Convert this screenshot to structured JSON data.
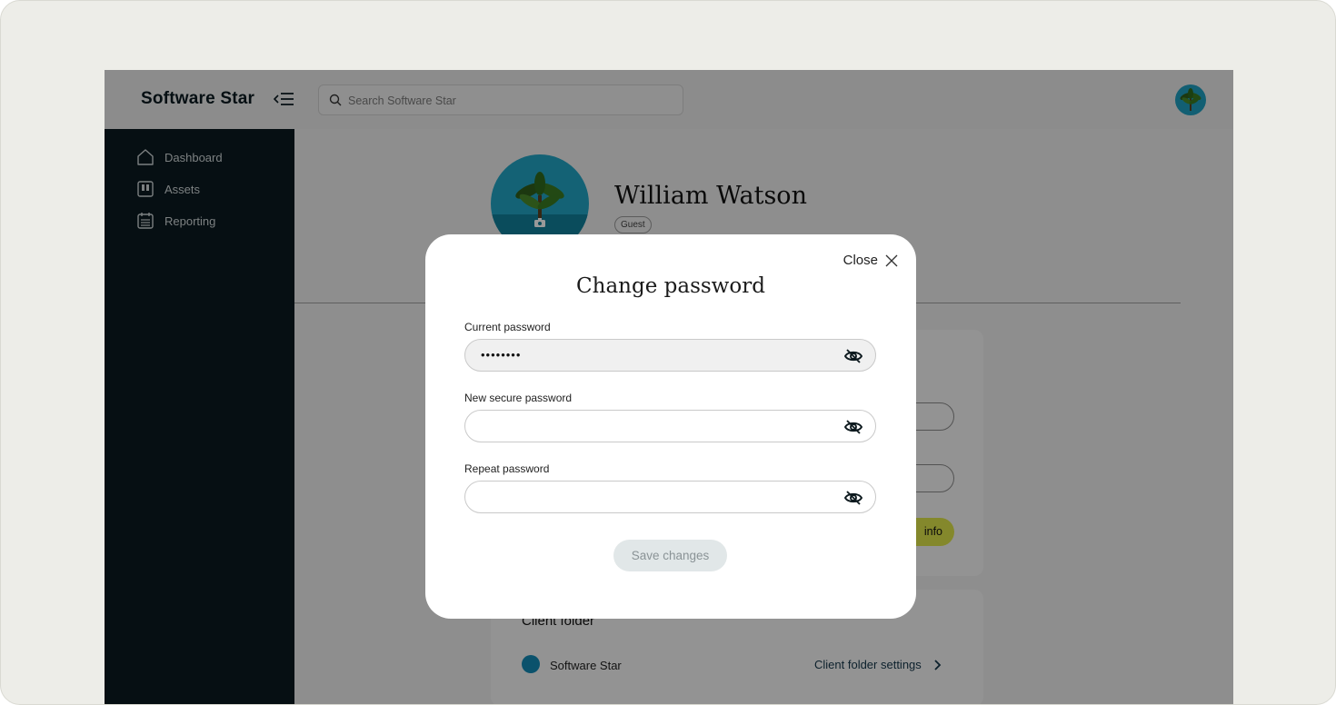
{
  "app": {
    "brand": "Software Star",
    "search_placeholder": "Search Software Star"
  },
  "sidebar": {
    "items": [
      {
        "label": "Dashboard",
        "icon": "home-icon"
      },
      {
        "label": "Assets",
        "icon": "assets-icon"
      },
      {
        "label": "Reporting",
        "icon": "calendar-icon"
      }
    ]
  },
  "profile": {
    "name": "William Watson",
    "role_badge": "Guest"
  },
  "client_folder": {
    "title": "Client folder",
    "folder_name": "Software Star",
    "settings_link": "Client folder settings"
  },
  "background_card": {
    "button_label_fragment": "info"
  },
  "modal": {
    "close_label": "Close",
    "title": "Change password",
    "fields": [
      {
        "label": "Current password",
        "value": "••••••••",
        "filled": true
      },
      {
        "label": "New secure password",
        "value": "",
        "filled": false
      },
      {
        "label": "Repeat password",
        "value": "",
        "filled": false
      }
    ],
    "save_label": "Save changes"
  },
  "colors": {
    "sidebar": "#0a1a20",
    "accent_yellow": "#dde34a",
    "folder_dot": "#1389b5",
    "avatar_teal": "#22a4c4"
  }
}
